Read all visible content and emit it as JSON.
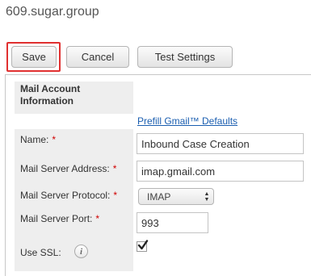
{
  "page": {
    "title": "609.sugar.group"
  },
  "toolbar": {
    "save_label": "Save",
    "cancel_label": "Cancel",
    "test_settings_label": "Test Settings"
  },
  "form": {
    "section_label": "Mail Account Information",
    "prefill_link": "Prefill Gmail™ Defaults",
    "required_marker": "*",
    "fields": {
      "name": {
        "label": "Name:",
        "value": "Inbound Case Creation"
      },
      "server_address": {
        "label": "Mail Server Address:",
        "value": "imap.gmail.com"
      },
      "server_protocol": {
        "label": "Mail Server Protocol:",
        "value": "IMAP"
      },
      "server_port": {
        "label": "Mail Server Port:",
        "value": "993"
      },
      "use_ssl": {
        "label": "Use SSL:",
        "checked": true
      }
    }
  },
  "icons": {
    "info": "info-icon",
    "checkmark": "checkmark-icon",
    "select_arrows": "up-down-arrows-icon"
  },
  "colors": {
    "highlight": "#e03030",
    "link": "#1a5eb0",
    "required": "#d00000",
    "label_bg": "#eeeeee"
  }
}
